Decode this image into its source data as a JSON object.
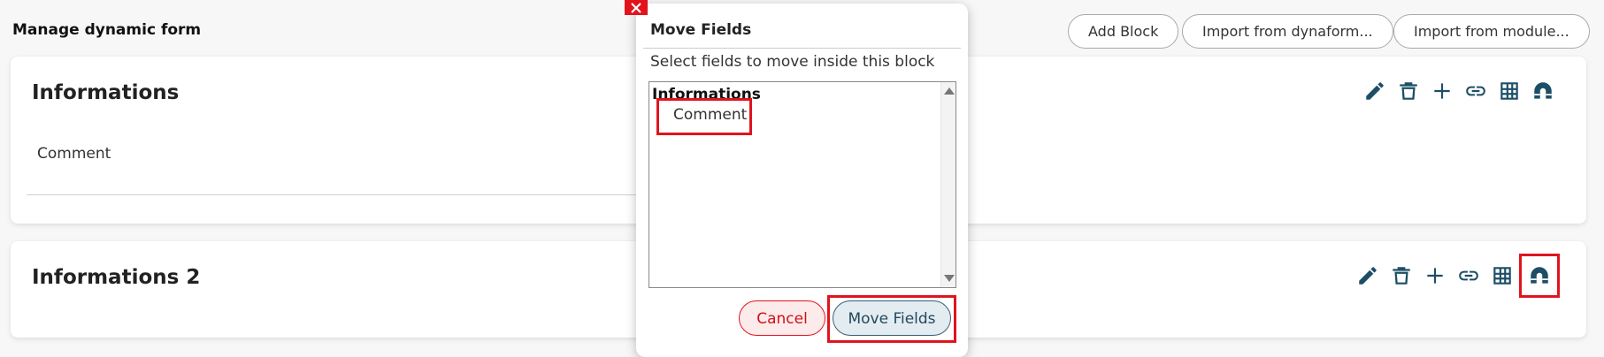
{
  "page": {
    "title": "Manage dynamic form"
  },
  "toolbar": {
    "add_block": "Add Block",
    "import_dynaform": "Import from dynaform...",
    "import_module": "Import from module..."
  },
  "blocks": [
    {
      "title": "Informations",
      "fields": [
        "Comment"
      ]
    },
    {
      "title": "Informations 2",
      "fields": []
    }
  ],
  "block_actions": [
    "edit-icon",
    "trash-icon",
    "plus-icon",
    "link-icon",
    "grid-icon",
    "magnet-icon"
  ],
  "dialog": {
    "title": "Move Fields",
    "description": "Select fields to move inside this block",
    "group_label": "Informations",
    "options": [
      "Comment"
    ],
    "cancel_label": "Cancel",
    "confirm_label": "Move Fields"
  },
  "colors": {
    "accent": "#1d4e66",
    "highlight": "#e0141e",
    "cancel": "#d0101a"
  }
}
